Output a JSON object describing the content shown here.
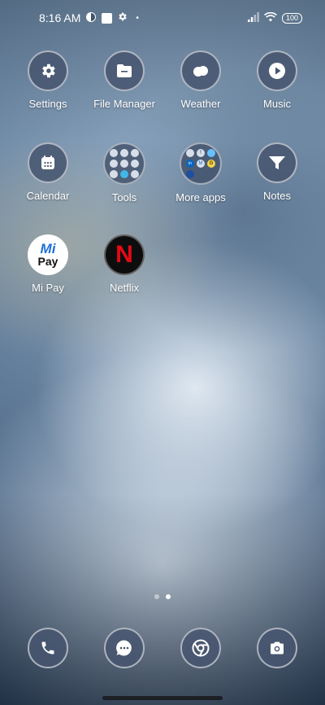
{
  "status_bar": {
    "time": "8:16 AM",
    "dot": "•",
    "battery": "100"
  },
  "apps": {
    "settings": "Settings",
    "file_manager": "File Manager",
    "weather": "Weather",
    "music": "Music",
    "calendar": "Calendar",
    "tools": "Tools",
    "more_apps": "More apps",
    "notes": "Notes",
    "mi_pay": "Mi Pay",
    "netflix": "Netflix"
  },
  "mi_pay_logo": {
    "mi": "Mi",
    "pay": "Pay"
  },
  "netflix_logo": "N",
  "more_apps_minis": [
    "in",
    "f",
    "M",
    "G"
  ],
  "page_indicator": {
    "pages": 2,
    "active": 2
  },
  "colors": {
    "accent_netflix": "#e50914",
    "mi_pay_blue": "#1e6fd9",
    "icon_bg": "#46556e"
  }
}
